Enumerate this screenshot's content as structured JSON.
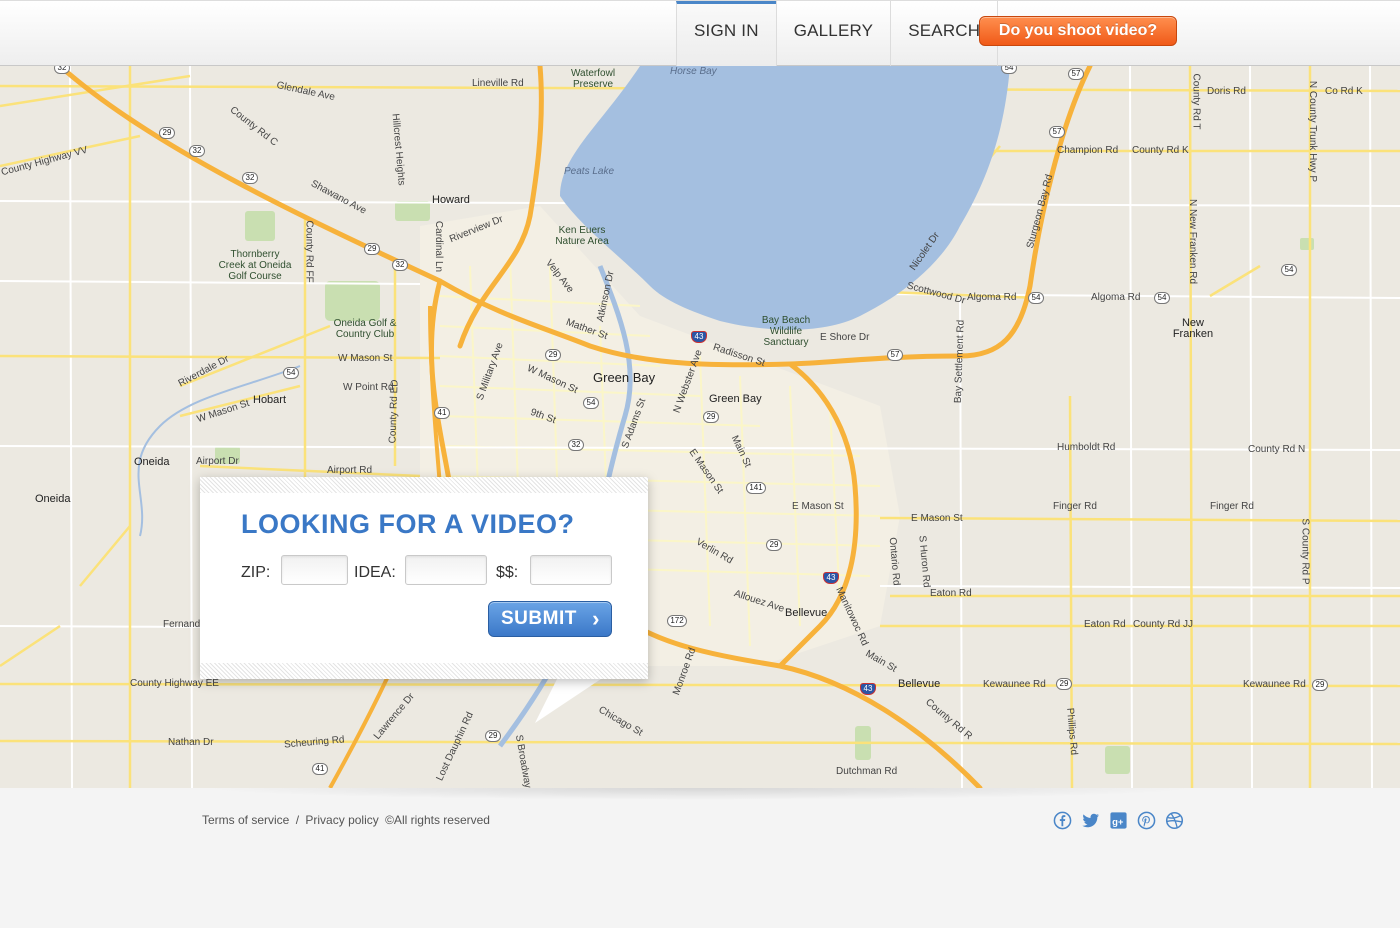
{
  "nav": {
    "items": [
      {
        "label": "SIGN IN",
        "active": true
      },
      {
        "label": "GALLERY",
        "active": false
      },
      {
        "label": "SEARCH",
        "active": false
      }
    ],
    "cta_label": "Do you shoot video?"
  },
  "map": {
    "cities": {
      "green_bay_main": "Green Bay",
      "green_bay_east": "Green Bay",
      "howard": "Howard",
      "hobart": "Hobart",
      "oneida_1": "Oneida",
      "oneida_2": "Oneida",
      "bellevue_1": "Bellevue",
      "bellevue_2": "Bellevue",
      "new_franken": "New Franken"
    },
    "water": {
      "horse_bay": "Horse Bay",
      "peats_lake": "Peats Lake"
    },
    "parks": {
      "waterfowl": "Waterfowl Preserve",
      "ken_euers": "Ken Euers Nature Area",
      "bay_beach": "Bay Beach Wildlife Sanctuary",
      "thornberry": "Thornberry Creek at Oneida Golf Course",
      "oneida_golf": "Oneida Golf & Country Club"
    },
    "roads": {
      "lineville": "Lineville Rd",
      "glendale": "Glendale Ave",
      "shawano": "Shawano Ave",
      "riverview": "Riverview Dr",
      "w_mason_1": "W Mason St",
      "w_mason_2": "W Mason St",
      "w_mason_3": "W Mason St",
      "w_point": "W Point Rd",
      "airport": "Airport Dr",
      "airport_rd": "Airport Rd",
      "radisson": "Radisson St",
      "e_shore": "E Shore Dr",
      "scottwood": "Scottwood Dr",
      "algoma_1": "Algoma Rd",
      "algoma_2": "Algoma Rd",
      "champion": "Champion Rd",
      "county_k": "County Rd K",
      "doris": "Doris Rd",
      "co_rd_k": "Co Rd K",
      "humboldt": "Humboldt Rd",
      "county_n": "County Rd N",
      "finger_1": "Finger Rd",
      "finger_2": "Finger Rd",
      "e_mason_1": "E Mason St",
      "e_mason_2": "E Mason St",
      "eaton_1": "Eaton Rd",
      "eaton_2": "Eaton Rd",
      "county_jj": "County Rd JJ",
      "kewaunee_1": "Kewaunee Rd",
      "kewaunee_2": "Kewaunee Rd",
      "county_ee": "County Highway EE",
      "nathan": "Nathan Dr",
      "scheuring": "Scheuring Rd",
      "dutchman": "Dutchman Rd",
      "fernando": "Fernando",
      "verlin": "Verlin Rd",
      "allouez": "Allouez Ave",
      "chicago": "Chicago St",
      "mather": "Mather St",
      "ninth": "9th St",
      "main_1": "Main St",
      "main_2": "Main St",
      "county_vv": "County Highway VV",
      "county_c": "County Rd C",
      "hillcrest": "Hillcrest Heights",
      "cardinal": "Cardinal Ln",
      "sturgeon": "Sturgeon Bay Rd",
      "nicolet": "Nicolet Dr",
      "bay_settlement": "Bay Settlement Rd",
      "velp": "Velp Ave",
      "atkinson": "Atkinson Dr",
      "s_military": "S Military Ave",
      "s_adams": "S Adams St",
      "n_webster": "N Webster Ave",
      "e_mason_st": "E Mason St",
      "manitowoc": "Manitowoc Rd",
      "county_r": "County Rd R",
      "ontario": "Ontario Rd",
      "s_huron": "S Huron Rd",
      "phillips": "Phillips Rd",
      "lawrence": "Lawrence Dr",
      "lost_dauphin": "Lost Dauphin Rd",
      "s_broadway": "S Broadway",
      "monroe": "Monroe Rd",
      "county_ff": "County Rd FF",
      "county_ed": "County Rd ED",
      "n_county_p": "N County Trunk Hwy P",
      "county_t": "County Rd T",
      "n_new_franken": "N New Franken Rd",
      "s_county_p": "S County Rd P",
      "riverdale": "Riverdale Dr"
    },
    "shields": [
      "32",
      "29",
      "32",
      "32",
      "29",
      "32",
      "54",
      "29",
      "54",
      "41",
      "32",
      "54",
      "29",
      "141",
      "29",
      "43",
      "43",
      "43",
      "57",
      "57",
      "54",
      "54",
      "54",
      "57",
      "172",
      "41",
      "29",
      "29",
      "29"
    ]
  },
  "search_form": {
    "title": "LOOKING FOR A VIDEO?",
    "fields": [
      {
        "label": "ZIP:",
        "value": "",
        "placeholder": ""
      },
      {
        "label": "IDEA:",
        "value": "",
        "placeholder": ""
      },
      {
        "label": "$$:",
        "value": "",
        "placeholder": ""
      }
    ],
    "submit_label": "SUBMIT",
    "submit_icon": "chevron-right-icon"
  },
  "footer": {
    "terms": "Terms of service",
    "separator": "/",
    "privacy": "Privacy policy",
    "rights": "©All rights reserved",
    "social_icons": [
      "facebook-icon",
      "twitter-icon",
      "google-plus-icon",
      "pinterest-icon",
      "dribbble-icon"
    ]
  },
  "colors": {
    "accent_blue": "#3a78c6",
    "cta_orange": "#f05a18",
    "water": "#a4bfe0",
    "highway": "#f7b23b"
  }
}
